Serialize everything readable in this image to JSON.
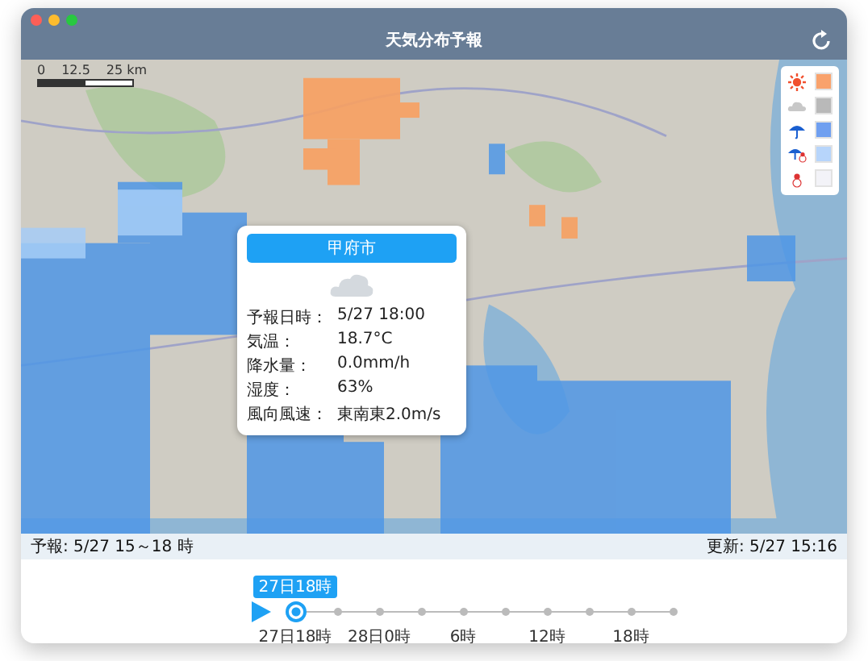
{
  "window": {
    "title": "天気分布予報"
  },
  "map": {
    "scale_labels": [
      "0",
      "12.5",
      "25 km"
    ]
  },
  "legend": [
    {
      "kind": "sun",
      "color": "#f9a26c"
    },
    {
      "kind": "cloud",
      "color": "#b9b9b9"
    },
    {
      "kind": "umbrella",
      "color": "#6f9ff0"
    },
    {
      "kind": "umbrella-snow",
      "color": "#b7d5fb"
    },
    {
      "kind": "snow",
      "color": "#f3f3f8"
    }
  ],
  "popup": {
    "title": "甲府市",
    "rows": [
      {
        "label": "予報日時：",
        "value": "5/27 18:00"
      },
      {
        "label": "気温：",
        "value": "18.7°C"
      },
      {
        "label": "降水量：",
        "value": "0.0mm/h"
      },
      {
        "label": "湿度：",
        "value": "63%"
      },
      {
        "label": "風向風速：",
        "value": "東南東2.0m/s"
      }
    ]
  },
  "status_bar": {
    "left": "予報: 5/27 15～18 時",
    "right": "更新: 5/27 15:16"
  },
  "timeline": {
    "tooltip": "27日18時",
    "points": [
      {
        "label": "27日18時",
        "selected": true
      },
      {
        "selected": false
      },
      {
        "label": "28日0時",
        "selected": false
      },
      {
        "selected": false
      },
      {
        "label": "6時",
        "selected": false
      },
      {
        "selected": false
      },
      {
        "label": "12時",
        "selected": false
      },
      {
        "selected": false
      },
      {
        "label": "18時",
        "selected": false
      },
      {
        "selected": false
      }
    ]
  }
}
